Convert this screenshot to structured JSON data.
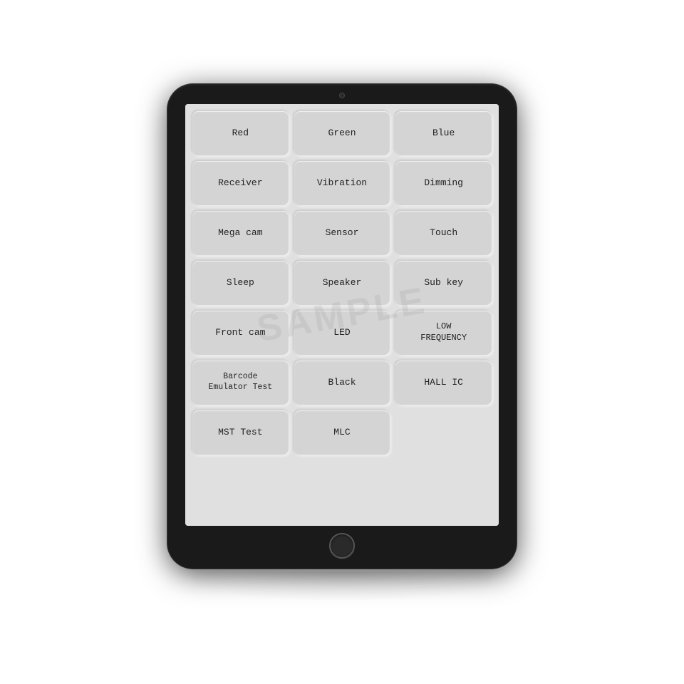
{
  "tablet": {
    "buttons": [
      {
        "label": "Red",
        "row": 1,
        "col": 1
      },
      {
        "label": "Green",
        "row": 1,
        "col": 2
      },
      {
        "label": "Blue",
        "row": 1,
        "col": 3
      },
      {
        "label": "Receiver",
        "row": 2,
        "col": 1
      },
      {
        "label": "Vibration",
        "row": 2,
        "col": 2
      },
      {
        "label": "Dimming",
        "row": 2,
        "col": 3
      },
      {
        "label": "Mega cam",
        "row": 3,
        "col": 1
      },
      {
        "label": "Sensor",
        "row": 3,
        "col": 2
      },
      {
        "label": "Touch",
        "row": 3,
        "col": 3
      },
      {
        "label": "Sleep",
        "row": 4,
        "col": 1
      },
      {
        "label": "Speaker",
        "row": 4,
        "col": 2
      },
      {
        "label": "Sub key",
        "row": 4,
        "col": 3
      },
      {
        "label": "Front cam",
        "row": 5,
        "col": 1
      },
      {
        "label": "LED",
        "row": 5,
        "col": 2
      },
      {
        "label": "LOW\nFREQUENCY",
        "row": 5,
        "col": 3
      },
      {
        "label": "Barcode\nEmulator Test",
        "row": 6,
        "col": 1
      },
      {
        "label": "Black",
        "row": 6,
        "col": 2
      },
      {
        "label": "HALL IC",
        "row": 6,
        "col": 3
      },
      {
        "label": "MST Test",
        "row": 7,
        "col": 1
      },
      {
        "label": "MLC",
        "row": 7,
        "col": 2
      }
    ],
    "watermark": "SAMPLE"
  }
}
